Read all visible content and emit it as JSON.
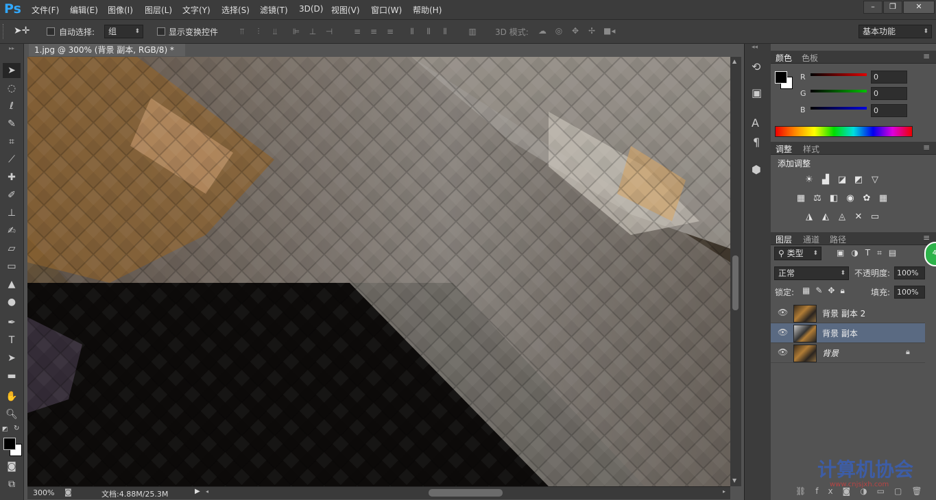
{
  "app": {
    "logo": "Ps"
  },
  "menu": [
    "文件(F)",
    "编辑(E)",
    "图像(I)",
    "图层(L)",
    "文字(Y)",
    "选择(S)",
    "滤镜(T)",
    "3D(D)",
    "视图(V)",
    "窗口(W)",
    "帮助(H)"
  ],
  "window_controls": {
    "minimize": "–",
    "restore": "❐",
    "close": "✕"
  },
  "options": {
    "auto_select_label": "自动选择:",
    "auto_select_value": "组",
    "show_transform_label": "显示变换控件",
    "mode_3d_label": "3D 模式:",
    "workspace": "基本功能"
  },
  "document": {
    "tab_title": "1.jpg @ 300% (背景 副本, RGB/8) *",
    "close": "×",
    "zoom": "300%",
    "doc_size": "文档:4.88M/25.3M"
  },
  "color_panel": {
    "tabs": [
      "颜色",
      "色板"
    ],
    "channels": [
      {
        "label": "R",
        "value": "0",
        "color": "#e00000"
      },
      {
        "label": "G",
        "value": "0",
        "color": "#00c000"
      },
      {
        "label": "B",
        "value": "0",
        "color": "#0000e0"
      }
    ]
  },
  "adjust_panel": {
    "tabs": [
      "调整",
      "样式"
    ],
    "add_label": "添加调整"
  },
  "layers_panel": {
    "tabs": [
      "图层",
      "通道",
      "路径"
    ],
    "filter": "类型",
    "blend_mode": "正常",
    "opacity_label": "不透明度:",
    "opacity": "100%",
    "lock_label": "锁定:",
    "fill_label": "填充:",
    "fill": "100%",
    "badge": "49",
    "layers": [
      {
        "name": "背景 副本 2",
        "selected": false,
        "locked": false
      },
      {
        "name": "背景 副本",
        "selected": true,
        "locked": false
      },
      {
        "name": "背景",
        "selected": false,
        "locked": true
      }
    ]
  },
  "watermark": {
    "text": "计算机协会",
    "url": "www.cnjsjxh.com"
  },
  "colors": {
    "accent": "#31a8ff",
    "selected_layer": "#5a6a82",
    "badge": "#2db34a"
  }
}
